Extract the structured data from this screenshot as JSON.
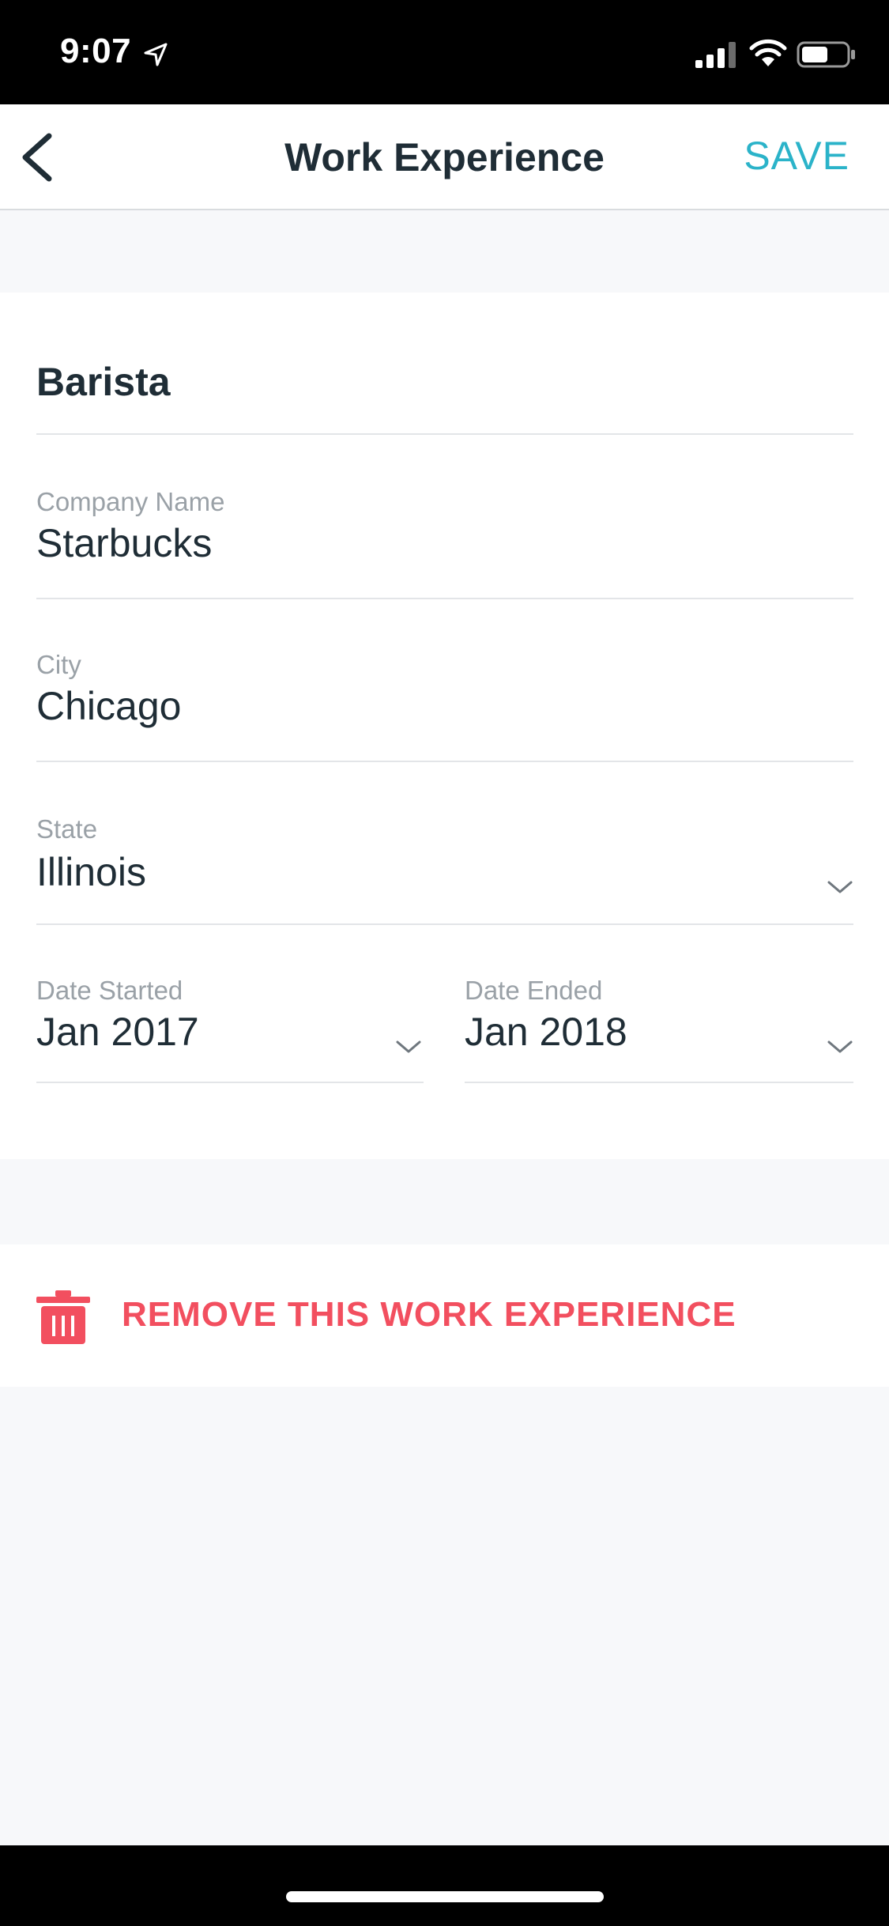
{
  "status_bar": {
    "time": "9:07"
  },
  "nav": {
    "title": "Work Experience",
    "save_label": "SAVE"
  },
  "form": {
    "job_title": "Barista",
    "company": {
      "label": "Company Name",
      "value": "Starbucks"
    },
    "city": {
      "label": "City",
      "value": "Chicago"
    },
    "state": {
      "label": "State",
      "value": "Illinois"
    },
    "date_started": {
      "label": "Date Started",
      "value": "Jan 2017"
    },
    "date_ended": {
      "label": "Date Ended",
      "value": "Jan 2018"
    }
  },
  "remove": {
    "label": "REMOVE THIS WORK EXPERIENCE"
  },
  "colors": {
    "accent": "#2bb3c9",
    "danger": "#f24f5f",
    "text": "#1f2d36",
    "label": "#9aa1a7"
  },
  "icons": [
    "location-arrow-icon",
    "signal-icon",
    "wifi-icon",
    "battery-icon",
    "back-chevron-icon",
    "chevron-down-icon",
    "trash-icon"
  ]
}
